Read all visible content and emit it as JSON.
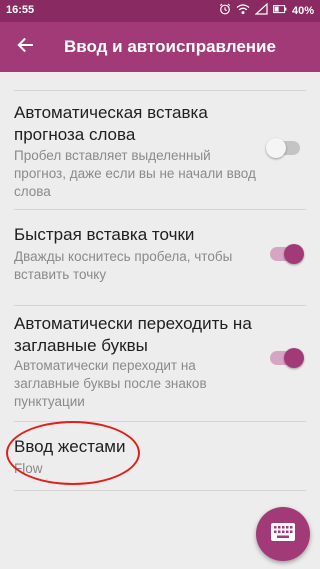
{
  "status_bar": {
    "time": "16:55",
    "battery_percent": "40%",
    "icons": [
      "alarm-icon",
      "wifi-icon",
      "signal-icon",
      "battery-icon"
    ]
  },
  "app_bar": {
    "title": "Ввод и автоисправление",
    "back_icon": "arrow-back-icon"
  },
  "preferences": [
    {
      "title": "Автоматическая вставка прогноза слова",
      "summary": "Пробел вставляет выделенный прогноз, даже если вы не начали ввод слова",
      "switch": "off"
    },
    {
      "title": "Быстрая вставка точки",
      "summary": "Дважды коснитесь пробела, чтобы вставить точку",
      "switch": "on"
    },
    {
      "title": "Автоматически переходить на заглавные буквы",
      "summary": "Автоматически переходит на заглавные буквы после знаков пунктуации",
      "switch": "on"
    },
    {
      "title": "Ввод жестами",
      "summary": "Flow"
    }
  ],
  "fab": {
    "icon": "keyboard-icon"
  },
  "colors": {
    "status_bar": "#8a2a63",
    "app_bar": "#a33a78",
    "accent": "#a33a78",
    "annotation": "#e0201c"
  }
}
